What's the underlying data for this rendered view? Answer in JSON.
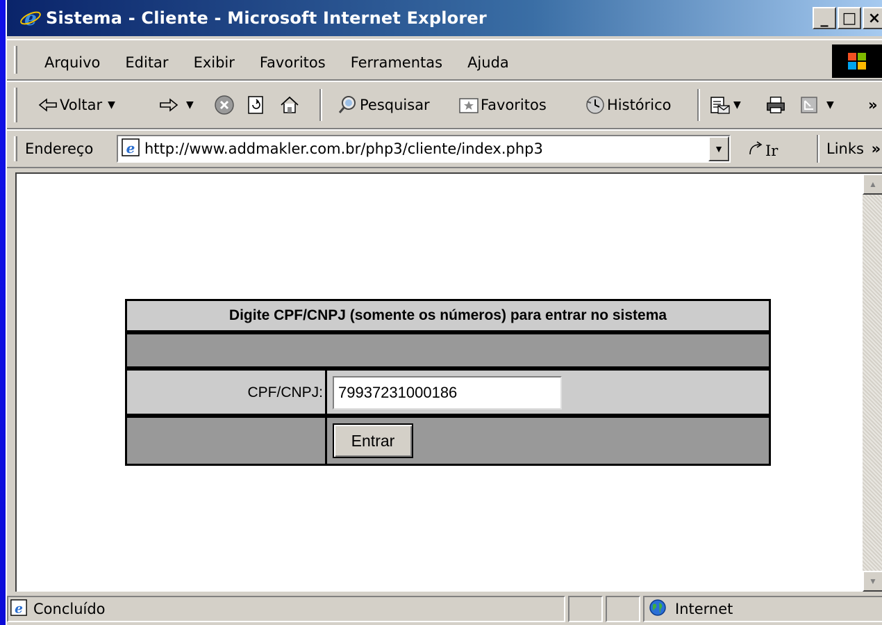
{
  "window": {
    "title": "Sistema - Cliente - Microsoft Internet Explorer",
    "caption_buttons": [
      "_",
      "□",
      "×"
    ]
  },
  "menu": {
    "items": [
      "Arquivo",
      "Editar",
      "Exibir",
      "Favoritos",
      "Ferramentas",
      "Ajuda"
    ]
  },
  "toolbar": {
    "back_label": "Voltar",
    "search_label": "Pesquisar",
    "favorites_label": "Favoritos",
    "history_label": "Histórico",
    "overflow": "»"
  },
  "address": {
    "label": "Endereço",
    "url": "http://www.addmakler.com.br/php3/cliente/index.php3",
    "go_label": "Ir",
    "links_label": "Links",
    "links_overflow": "»"
  },
  "login": {
    "header": "Digite CPF/CNPJ (somente os números) para entrar no sistema",
    "field_label": "CPF/CNPJ:",
    "field_value": "79937231000186",
    "submit_label": "Entrar",
    "header_bg": "#cccccc",
    "dark_row_bg": "#999999"
  },
  "status": {
    "text": "Concluído",
    "zone": "Internet"
  },
  "colors": {
    "slide_background": "#1414f0",
    "title_bar": "#0a246a",
    "chrome": "#d4d0c8"
  }
}
